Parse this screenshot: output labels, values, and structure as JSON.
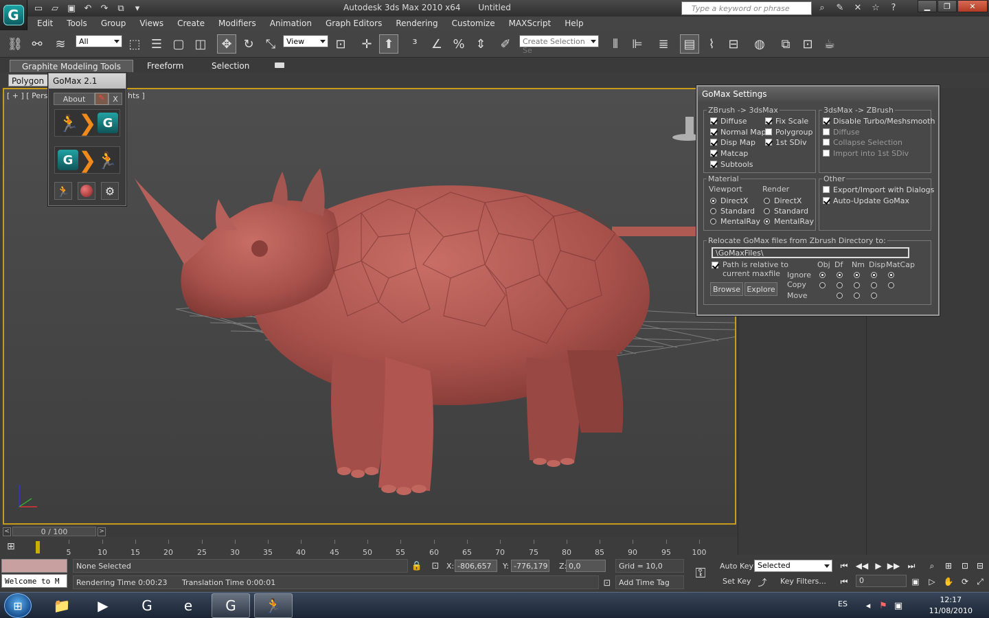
{
  "window": {
    "app_name": "Autodesk 3ds Max  2010 x64",
    "doc_name": "Untitled",
    "search_placeholder": "Type a keyword or phrase",
    "minimize": "▁",
    "maximize": "❐",
    "close": "✕"
  },
  "menu": [
    "Edit",
    "Tools",
    "Group",
    "Views",
    "Create",
    "Modifiers",
    "Animation",
    "Graph Editors",
    "Rendering",
    "Customize",
    "MAXScript",
    "Help"
  ],
  "toolbar": {
    "selection_filter": "All",
    "ref_coord": "View",
    "named_selection": "Create Selection Se"
  },
  "ribbon": {
    "tabs": [
      "Graphite Modeling Tools",
      "Freeform",
      "Selection"
    ],
    "active_tab": "Graphite Modeling Tools",
    "sub_tab": "Polygon M"
  },
  "viewport": {
    "label_left": "[ + ] [ Perspe",
    "label_right": "hts ]",
    "accent": "#c89b1a",
    "model_color": "#b85a54"
  },
  "gomax_small": {
    "title": "GoMax 2.1",
    "about": "About",
    "close": "X"
  },
  "gomax_settings": {
    "title": "GoMax Settings",
    "zb_to_max": {
      "title": "ZBrush -> 3dsMax",
      "items": [
        {
          "label": "Diffuse",
          "checked": true
        },
        {
          "label": "Normal Map",
          "checked": true
        },
        {
          "label": "Disp Map",
          "checked": true
        },
        {
          "label": "Matcap",
          "checked": true
        },
        {
          "label": "Subtools",
          "checked": true
        }
      ],
      "items_right": [
        {
          "label": "Fix Scale",
          "checked": true
        },
        {
          "label": "Polygroup",
          "checked": false
        },
        {
          "label": "1st SDiv",
          "checked": true
        }
      ]
    },
    "max_to_zb": {
      "title": "3dsMax -> ZBrush",
      "items": [
        {
          "label": "Disable Turbo/Meshsmooth",
          "checked": true
        },
        {
          "label": "Diffuse",
          "checked": false
        },
        {
          "label": "Collapse Selection",
          "checked": false
        },
        {
          "label": "Import into 1st SDiv",
          "checked": false
        }
      ]
    },
    "material": {
      "title": "Material",
      "viewport_label": "Viewport",
      "render_label": "Render",
      "viewport_opts": [
        "DirectX",
        "Standard",
        "MentalRay"
      ],
      "viewport_sel": 0,
      "render_opts": [
        "DirectX",
        "Standard",
        "MentalRay"
      ],
      "render_sel": 2
    },
    "other": {
      "title": "Other",
      "items": [
        {
          "label": "Export/Import with Dialogs",
          "checked": false
        },
        {
          "label": "Auto-Update GoMax",
          "checked": true
        }
      ]
    },
    "relocate": {
      "title": "Relocate GoMax files from Zbrush Directory to:",
      "path": "\\GoMaxFiles\\",
      "relative_line1": "Path is relative to",
      "relative_line2": "current maxfile",
      "relative_checked": true,
      "col_headers": [
        "Obj",
        "Df",
        "Nm",
        "Disp",
        "MatCap"
      ],
      "row_labels": [
        "Ignore",
        "Copy",
        "Move"
      ],
      "browse": "Browse",
      "explore": "Explore"
    }
  },
  "timeline": {
    "thumb": "0 / 100",
    "ticks": [
      5,
      10,
      15,
      20,
      25,
      30,
      35,
      40,
      45,
      50,
      55,
      60,
      65,
      70,
      75,
      80,
      85,
      90,
      95,
      100
    ],
    "max": 100
  },
  "status": {
    "welcome": "Welcome to M",
    "selection": "None Selected",
    "render_time": "Rendering Time  0:00:23",
    "translation_time": "Translation Time  0:00:01",
    "x_label": "X:",
    "x_value": "-806,657",
    "y_label": "Y:",
    "y_value": "-776,179",
    "z_label": "Z:",
    "z_value": "0,0",
    "grid": "Grid = 10,0",
    "add_time_tag": "Add Time Tag",
    "auto_key": "Auto Key",
    "set_key": "Set Key",
    "selected": "Selected",
    "key_filters": "Key Filters...",
    "frame": "0"
  },
  "taskbar": {
    "lang": "ES",
    "time": "12:17",
    "date": "11/08/2010"
  }
}
